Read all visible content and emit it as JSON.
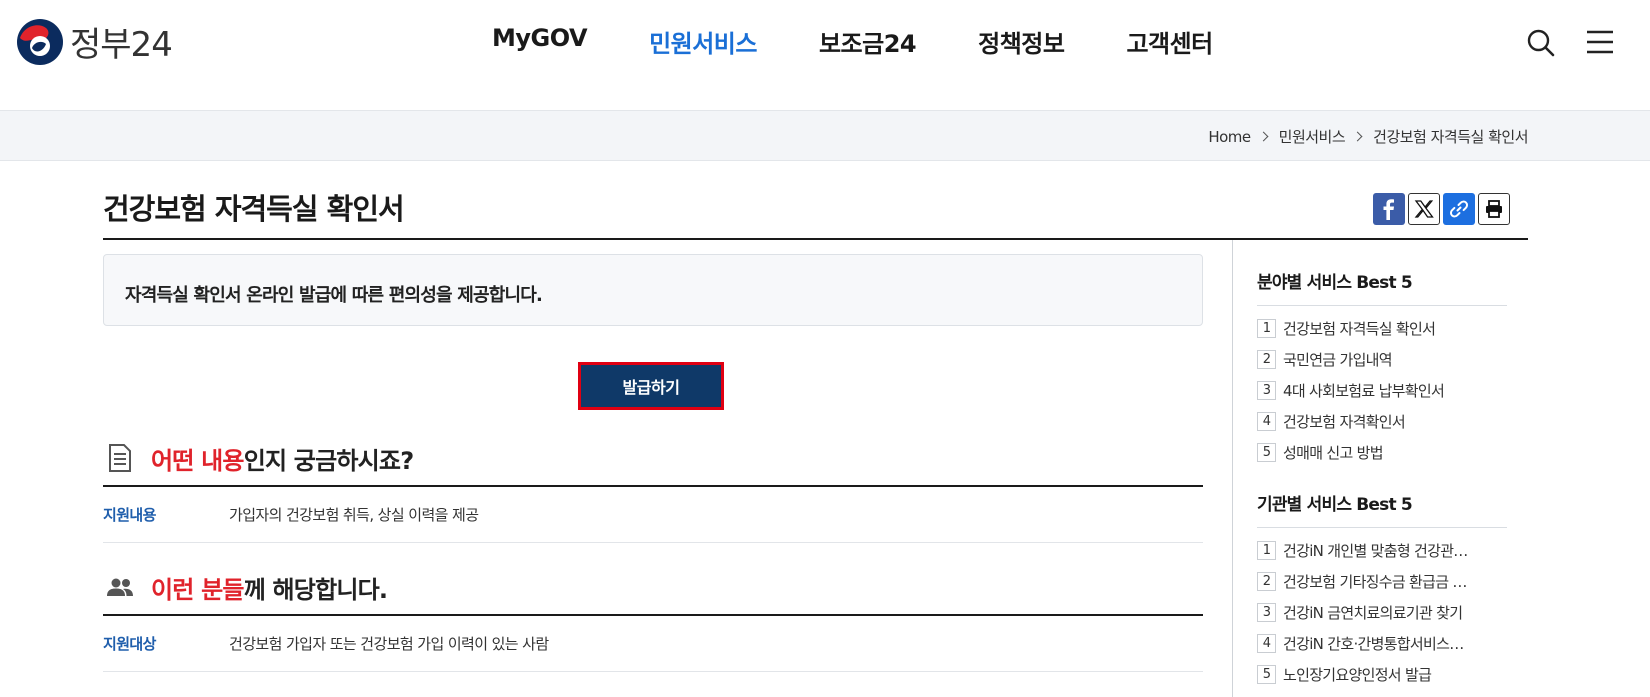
{
  "header": {
    "logo_text": "정부24",
    "nav": [
      "MyGOV",
      "민원서비스",
      "보조금24",
      "정책정보",
      "고객센터"
    ],
    "active_index": 1,
    "accent_color": "#1a6fd6"
  },
  "breadcrumb": [
    "Home",
    "민원서비스",
    "건강보험 자격득실 확인서"
  ],
  "page": {
    "title": "건강보험 자격득실 확인서",
    "share_icons": [
      "facebook-icon",
      "x-icon",
      "link-icon",
      "print-icon"
    ],
    "intro": "자격득실 확인서 온라인 발급에 따른 편의성을 제공합니다.",
    "issue_button": "발급하기"
  },
  "sections": [
    {
      "title_highlight": "어떤 내용",
      "title_rest": "인지 궁금하시죠?",
      "icon": "document-icon",
      "key": "지원내용",
      "value": "가입자의 건강보험 취득, 상실 이력을 제공"
    },
    {
      "title_highlight": "이런 분들",
      "title_rest": "께 해당합니다.",
      "icon": "people-icon",
      "key": "지원대상",
      "value": "건강보험 가입자 또는 건강보험 가입 이력이 있는 사람"
    }
  ],
  "sidebar": {
    "field_title": "분야별 서비스 Best 5",
    "field_items": [
      "건강보험 자격득실 확인서",
      "국민연금 가입내역",
      "4대 사회보험료 납부확인서",
      "건강보험 자격확인서",
      "성매매 신고 방법"
    ],
    "org_title": "기관별 서비스 Best 5",
    "org_items": [
      "건강iN 개인별 맞춤형 건강관…",
      "건강보험 기타징수금 환급금 …",
      "건강iN 금연치료의료기관 찾기",
      "건강iN 간호·간병통합서비스…",
      "노인장기요양인정서 발급"
    ]
  }
}
